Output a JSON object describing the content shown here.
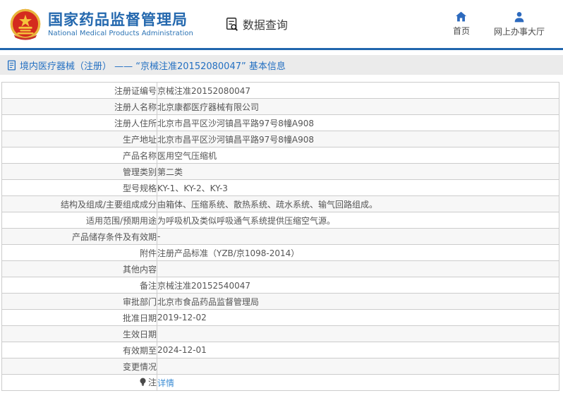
{
  "header": {
    "org_name_cn": "国家药品监督管理局",
    "org_name_en": "National Medical Products Administration",
    "data_query_label": "数据查询",
    "nav_home_label": "首页",
    "nav_hall_label": "网上办事大厅"
  },
  "title_bar": {
    "title": "境内医疗器械（注册） —— “京械注准20152080047” 基本信息"
  },
  "table": {
    "rows": [
      {
        "label": "注册证编号",
        "value": "京械注准20152080047"
      },
      {
        "label": "注册人名称",
        "value": "北京康都医疗器械有限公司"
      },
      {
        "label": "注册人住所",
        "value": "北京市昌平区沙河镇昌平路97号8幢A908"
      },
      {
        "label": "生产地址",
        "value": "北京市昌平区沙河镇昌平路97号8幢A908"
      },
      {
        "label": "产品名称",
        "value": "医用空气压缩机"
      },
      {
        "label": "管理类别",
        "value": "第二类"
      },
      {
        "label": "型号规格",
        "value": "KY-1、KY-2、KY-3"
      },
      {
        "label": "结构及组成/主要组成成分",
        "value": "由箱体、压缩系统、散热系统、疏水系统、输气回路组成。"
      },
      {
        "label": "适用范围/预期用途",
        "value": "为呼吸机及类似呼吸通气系统提供压缩空气源。"
      },
      {
        "label": "产品储存条件及有效期",
        "value": "-"
      },
      {
        "label": "附件",
        "value": "注册产品标准（YZB/京1098-2014）"
      },
      {
        "label": "其他内容",
        "value": ""
      },
      {
        "label": "备注",
        "value": "京械注准20152540047"
      },
      {
        "label": "审批部门",
        "value": "北京市食品药品监督管理局"
      },
      {
        "label": "批准日期",
        "value": "2019-12-02"
      },
      {
        "label": "生效日期",
        "value": ""
      },
      {
        "label": "有效期至",
        "value": "2024-12-01"
      },
      {
        "label": "变更情况",
        "value": ""
      },
      {
        "label": "注",
        "value": "详情",
        "link": true,
        "icon": "bulb-icon"
      }
    ]
  },
  "colors": {
    "accent_blue": "#2468ae",
    "separator_blue": "#2166ad",
    "link_blue": "#3c8dd4",
    "title_bar_bg": "#ebebeb",
    "row_stripe": "#f7f7f7",
    "table_border": "#cccccc",
    "emblem_red": "#d42b1e",
    "emblem_gold": "#e9b63c",
    "icon_blue": "#2d6abe"
  }
}
